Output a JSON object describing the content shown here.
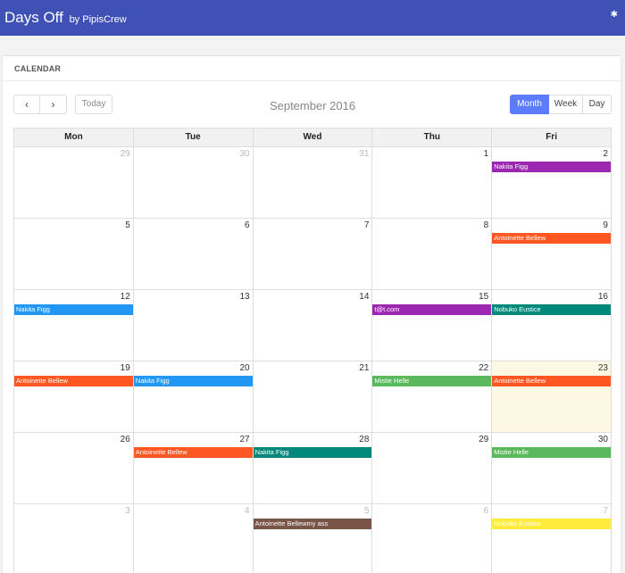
{
  "header": {
    "title": "Days Off",
    "subtitle": "by PipisCrew",
    "pin_glyph": "✱"
  },
  "card": {
    "title": "CALENDAR"
  },
  "toolbar": {
    "prev_glyph": "‹",
    "next_glyph": "›",
    "today_label": "Today",
    "period": "September 2016",
    "views": [
      "Month",
      "Week",
      "Day"
    ],
    "active_view": "Month"
  },
  "calendar": {
    "weekdays": [
      "Mon",
      "Tue",
      "Wed",
      "Thu",
      "Fri"
    ],
    "weeks": [
      [
        {
          "day": "29",
          "other": true,
          "events": []
        },
        {
          "day": "30",
          "other": true,
          "events": []
        },
        {
          "day": "31",
          "other": true,
          "events": []
        },
        {
          "day": "1",
          "events": []
        },
        {
          "day": "2",
          "events": [
            {
              "name": "Nakita Figg",
              "color": "#9c27b0"
            }
          ]
        }
      ],
      [
        {
          "day": "5",
          "events": []
        },
        {
          "day": "6",
          "events": []
        },
        {
          "day": "7",
          "events": []
        },
        {
          "day": "8",
          "events": []
        },
        {
          "day": "9",
          "events": [
            {
              "name": "Antoinette Bellew",
              "color": "#ff5722"
            }
          ]
        }
      ],
      [
        {
          "day": "12",
          "events": [
            {
              "name": "Nakita Figg",
              "color": "#2196f3"
            }
          ]
        },
        {
          "day": "13",
          "events": []
        },
        {
          "day": "14",
          "events": []
        },
        {
          "day": "15",
          "events": [
            {
              "name": "t@t.com",
              "color": "#9c27b0"
            }
          ]
        },
        {
          "day": "16",
          "events": [
            {
              "name": "Nobuko Eustice",
              "color": "#00897b"
            }
          ]
        }
      ],
      [
        {
          "day": "19",
          "events": [
            {
              "name": "Antoinette Bellew",
              "color": "#ff5722"
            }
          ]
        },
        {
          "day": "20",
          "events": [
            {
              "name": "Nakita Figg",
              "color": "#2196f3"
            }
          ]
        },
        {
          "day": "21",
          "events": []
        },
        {
          "day": "22",
          "events": [
            {
              "name": "Mistie Helle",
              "color": "#5cb85c"
            }
          ]
        },
        {
          "day": "23",
          "today": true,
          "events": [
            {
              "name": "Antoinette Bellew",
              "color": "#ff5722"
            }
          ]
        }
      ],
      [
        {
          "day": "26",
          "events": []
        },
        {
          "day": "27",
          "events": [
            {
              "name": "Antoinette Bellew",
              "color": "#ff5722"
            }
          ]
        },
        {
          "day": "28",
          "events": [
            {
              "name": "Nakita Figg",
              "color": "#00897b"
            }
          ]
        },
        {
          "day": "29",
          "events": []
        },
        {
          "day": "30",
          "events": [
            {
              "name": "Mistie Helle",
              "color": "#5cb85c"
            }
          ]
        }
      ],
      [
        {
          "day": "3",
          "other": true,
          "events": []
        },
        {
          "day": "4",
          "other": true,
          "events": []
        },
        {
          "day": "5",
          "other": true,
          "events": [
            {
              "name": "Antoinette Bellewmy ass",
              "color": "#795548"
            }
          ]
        },
        {
          "day": "6",
          "other": true,
          "events": []
        },
        {
          "day": "7",
          "other": true,
          "events": [
            {
              "name": "Nobuko Eustice",
              "color": "#ffeb3b"
            }
          ]
        }
      ]
    ]
  }
}
